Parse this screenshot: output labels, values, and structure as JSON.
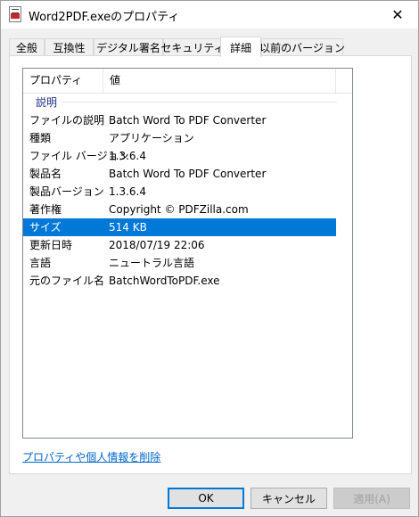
{
  "window": {
    "title": "Word2PDF.exeのプロパティ",
    "close_glyph": "✕"
  },
  "tabs": [
    {
      "label": "全般"
    },
    {
      "label": "互換性"
    },
    {
      "label": "デジタル署名"
    },
    {
      "label": "セキュリティ"
    },
    {
      "label": "詳細",
      "active": true
    },
    {
      "label": "以前のバージョン"
    }
  ],
  "details": {
    "columns": {
      "property": "プロパティ",
      "value": "値"
    },
    "group": "説明",
    "rows": [
      {
        "key": "ファイルの説明",
        "value": "Batch Word To PDF Converter"
      },
      {
        "key": "種類",
        "value": "アプリケーション"
      },
      {
        "key": "ファイル バージョン",
        "value": "1.3.6.4"
      },
      {
        "key": "製品名",
        "value": "Batch Word To PDF Converter"
      },
      {
        "key": "製品バージョン",
        "value": "1.3.6.4"
      },
      {
        "key": "著作権",
        "value": "Copyright © PDFZilla.com"
      },
      {
        "key": "サイズ",
        "value": "514 KB",
        "selected": true
      },
      {
        "key": "更新日時",
        "value": "2018/07/19 22:06"
      },
      {
        "key": "言語",
        "value": "ニュートラル言語"
      },
      {
        "key": "元のファイル名",
        "value": "BatchWordToPDF.exe"
      }
    ]
  },
  "footer": {
    "remove_link": "プロパティや個人情報を削除",
    "ok": "OK",
    "cancel": "キャンセル",
    "apply": "適用(A)"
  },
  "colors": {
    "selection": "#0078d7",
    "link": "#0066cc",
    "group_header": "#1e3287"
  },
  "icons": {
    "app": "pdf-exe-icon",
    "close": "close-icon"
  }
}
